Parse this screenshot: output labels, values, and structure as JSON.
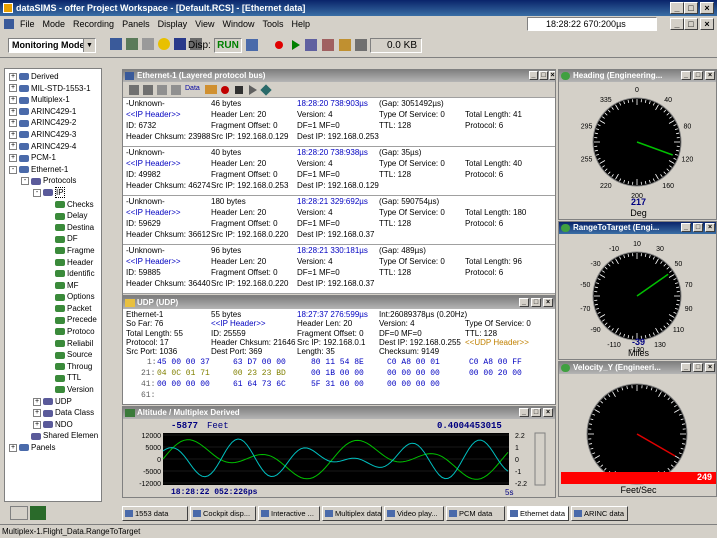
{
  "app": {
    "title": "dataSIMS - offer Project Workspace - [Default.RCS] - [Ethernet data]",
    "clock": "18:28:22 670:200µs",
    "kb": "0.0 KB",
    "mode": "Monitoring Mode",
    "disp": "Disp:",
    "run": "RUN"
  },
  "menu": [
    "File",
    "Mode",
    "Recording",
    "Panels",
    "Display",
    "View",
    "Window",
    "Tools",
    "Help"
  ],
  "tree": [
    {
      "t": "Derived",
      "l": 0,
      "pm": "+"
    },
    {
      "t": "MIL-STD-1553-1",
      "l": 0,
      "pm": "+"
    },
    {
      "t": "Multiplex-1",
      "l": 0,
      "pm": "+"
    },
    {
      "t": "ARINC429-1",
      "l": 0,
      "pm": "+"
    },
    {
      "t": "ARINC429-2",
      "l": 0,
      "pm": "+"
    },
    {
      "t": "ARINC429-3",
      "l": 0,
      "pm": "+"
    },
    {
      "t": "ARINC429-4",
      "l": 0,
      "pm": "+"
    },
    {
      "t": "PCM-1",
      "l": 0,
      "pm": "+"
    },
    {
      "t": "Ethernet-1",
      "l": 0,
      "pm": "-"
    },
    {
      "t": "Protocols",
      "l": 1,
      "pm": "-"
    },
    {
      "t": "IP",
      "l": 2,
      "pm": "-"
    },
    {
      "t": "Checks",
      "l": 3
    },
    {
      "t": "Delay",
      "l": 3
    },
    {
      "t": "Destina",
      "l": 3
    },
    {
      "t": "DF",
      "l": 3
    },
    {
      "t": "Fragme",
      "l": 3
    },
    {
      "t": "Header",
      "l": 3
    },
    {
      "t": "Identific",
      "l": 3
    },
    {
      "t": "MF",
      "l": 3
    },
    {
      "t": "Options",
      "l": 3
    },
    {
      "t": "Packet",
      "l": 3
    },
    {
      "t": "Precede",
      "l": 3
    },
    {
      "t": "Protoco",
      "l": 3
    },
    {
      "t": "Reliabil",
      "l": 3
    },
    {
      "t": "Source",
      "l": 3
    },
    {
      "t": "Throug",
      "l": 3
    },
    {
      "t": "TTL",
      "l": 3
    },
    {
      "t": "Version",
      "l": 3
    },
    {
      "t": "UDP",
      "l": 2,
      "pm": "+"
    },
    {
      "t": "Data Class",
      "l": 2,
      "pm": "+"
    },
    {
      "t": "NDO",
      "l": 2,
      "pm": "+"
    },
    {
      "t": "Shared Elemen",
      "l": 1
    },
    {
      "t": "Panels",
      "l": 0,
      "pm": "+"
    }
  ],
  "eth": {
    "title": "Ethernet-1 (Layered protocol bus)",
    "toolbar_data": "Data",
    "records": [
      {
        "a": [
          "-Unknown-",
          "46 bytes",
          "18:28:20 738:903µs",
          "(Gap: 3051492µs)",
          ""
        ],
        "b": [
          "<<IP Header>>",
          "Header Len: 20",
          "Version: 4",
          "Type Of Service: 0",
          "Total Length: 41"
        ],
        "c": [
          "ID: 6732",
          "Fragment Offset: 0",
          "DF=1 MF=0",
          "TTL: 128",
          "Protocol: 6"
        ],
        "d": [
          "Header Chksum: 23988",
          "Src IP: 192.168.0.129",
          "Dest IP: 192.168.0.253",
          "",
          ""
        ]
      },
      {
        "a": [
          "-Unknown-",
          "40 bytes",
          "18:28:20 738:938µs",
          "(Gap: 35µs)",
          ""
        ],
        "b": [
          "<<IP Header>>",
          "Header Len: 20",
          "Version: 4",
          "Type Of Service: 0",
          "Total Length: 40"
        ],
        "c": [
          "ID: 49982",
          "Fragment Offset: 0",
          "DF=1 MF=0",
          "TTL: 128",
          "Protocol: 6"
        ],
        "d": [
          "Header Chksum: 46274",
          "Src IP: 192.168.0.253",
          "Dest IP: 192.168.0.129",
          "",
          ""
        ]
      },
      {
        "a": [
          "-Unknown-",
          "180 bytes",
          "18:28:21 329:692µs",
          "(Gap: 590754µs)",
          ""
        ],
        "b": [
          "<<IP Header>>",
          "Header Len: 20",
          "Version: 4",
          "Type Of Service: 0",
          "Total Length: 180"
        ],
        "c": [
          "ID: 59629",
          "Fragment Offset: 0",
          "DF=1 MF=0",
          "TTL: 128",
          "Protocol: 6"
        ],
        "d": [
          "Header Chksum: 36612",
          "Src IP: 192.168.0.220",
          "Dest IP: 192.168.0.37",
          "",
          ""
        ]
      },
      {
        "a": [
          "-Unknown-",
          "96 bytes",
          "18:28:21 330:181µs",
          "(Gap: 489µs)",
          ""
        ],
        "b": [
          "<<IP Header>>",
          "Header Len: 20",
          "Version: 4",
          "Type Of Service: 0",
          "Total Length: 96"
        ],
        "c": [
          "ID: 59885",
          "Fragment Offset: 0",
          "DF=1 MF=0",
          "TTL: 128",
          "Protocol: 6"
        ],
        "d": [
          "Header Chksum: 36440",
          "Src IP: 192.168.0.220",
          "Dest IP: 192.168.0.37",
          "",
          ""
        ]
      }
    ]
  },
  "udp": {
    "title": "UDP (UDP)",
    "rows": [
      [
        "Ethernet-1",
        "55 bytes",
        "18:27:37 276:599µs",
        "Int:26089378µs (0.20Hz)",
        ""
      ],
      [
        "So Far: 76",
        "<<IP Header>>",
        "Header Len: 20",
        "Version: 4",
        "Type Of Service: 0"
      ],
      [
        "Total Length: 55",
        "ID: 25559",
        "Fragment Offset: 0",
        "DF=0 MF=0",
        "TTL: 128"
      ],
      [
        "Protocol: 17",
        "Header Chksum: 21646",
        "Src IP: 192.168.0.1",
        "Dest IP: 192.168.0.255",
        "<<UDP Header>>"
      ],
      [
        "Src Port: 1036",
        "Dest Port: 369",
        "Length: 35",
        "Checksum: 9149",
        ""
      ]
    ],
    "hex": [
      {
        "n": "1:",
        "g": [
          "45 00 00 37",
          "63 D7 00 00",
          "80 11 54 8E",
          "C0 A8 00 01",
          "C0 A8 00 FF"
        ]
      },
      {
        "n": "21:",
        "g": [
          "04 0C 01 71",
          "00 23 23 BD",
          "00 1B 00 00",
          "00 00 00 00",
          "00 00 20 00"
        ]
      },
      {
        "n": "41:",
        "g": [
          "00 00 00 00",
          "61 64 73 6C",
          "5F 31 00 00",
          "00 00 00 00",
          ""
        ]
      },
      {
        "n": "61:",
        "g": [
          "",
          "",
          "",
          "",
          ""
        ]
      }
    ]
  },
  "alt": {
    "title": "Altitude / Multiplex Derived",
    "value": "-5877",
    "unit": "Feet",
    "right_value": "0.4004453015",
    "time": "18:28:22 052:226ps",
    "span": "5s",
    "yticks": [
      "12000",
      "5000",
      "0",
      "-5000",
      "-12000"
    ],
    "rticks": [
      "2.2",
      "1",
      "0",
      "-1",
      "-2.2"
    ]
  },
  "gauges": [
    {
      "title": "Heading (Engineering...",
      "value": "217",
      "unit": "Deg",
      "ticks": [
        "0",
        "40",
        "80",
        "120",
        "160",
        "200",
        "220",
        "255",
        "295",
        "335"
      ]
    },
    {
      "title": "RangeToTarget (Engi...",
      "value": "-39",
      "unit": "Miles",
      "ticks": [
        "10",
        "30",
        "50",
        "70",
        "90",
        "110",
        "130",
        "-130",
        "-110",
        "-90",
        "-70",
        "-50",
        "-30",
        "-10"
      ]
    },
    {
      "title": "Velocity_Y (Engineeri...",
      "value": "249",
      "unit": "Feet/Sec"
    }
  ],
  "tabs": [
    "1553 data",
    "Cockpit disp...",
    "Interactive ...",
    "Multiplex data",
    "Video play...",
    "PCM data",
    "Ethernet data",
    "ARINC data"
  ],
  "status": "Multiplex-1.Flight_Data.RangeToTarget",
  "colors": {
    "accent": "#0a246a",
    "run": "#008000",
    "hex_blue": "#0000c0",
    "hex_olive": "#808000",
    "velocity_bar": "#ff0000"
  }
}
